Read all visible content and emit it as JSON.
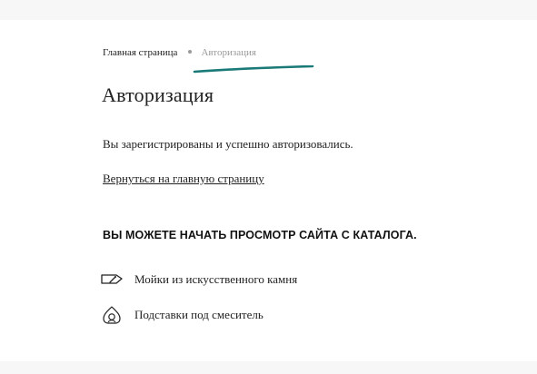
{
  "breadcrumb": {
    "home": "Главная страница",
    "current": "Авторизация"
  },
  "page": {
    "title": "Авторизация",
    "success_message": "Вы зарегистрированы и успешно авторизовались.",
    "home_link": "Вернуться на главную страницу"
  },
  "catalog": {
    "heading": "ВЫ МОЖЕТЕ НАЧАТЬ ПРОСМОТР САЙТА С КАТАЛОГА.",
    "items": [
      {
        "label": "Мойки из искусственного камня",
        "icon": "sink-icon"
      },
      {
        "label": "Подставки под смеситель",
        "icon": "faucet-stand-icon"
      }
    ]
  },
  "colors": {
    "annotation": "#1a7a78",
    "muted": "#9a9a9a",
    "text": "#222222"
  }
}
